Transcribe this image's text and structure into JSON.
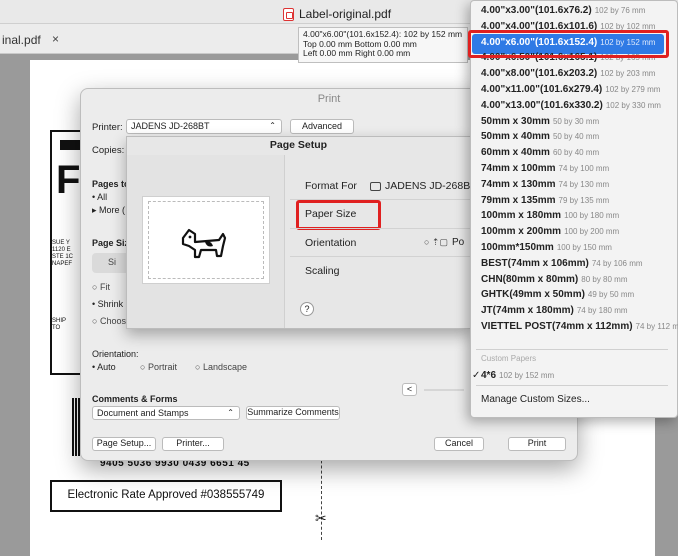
{
  "window": {
    "doc_title": "Label-original.pdf",
    "tab_label": "inal.pdf",
    "tab_close": "×"
  },
  "tooltip": {
    "line1": "4.00\"x6.00\"(101.6x152.4): 102 by 152 mm",
    "line2": "Top 0.00 mm  Bottom 0.00 mm",
    "line3": "Left 0.00 mm  Right 0.00 mm"
  },
  "document": {
    "tracking_number": "9405 5036 9930 0439 6651 45",
    "rate_text": "Electronic Rate Approved #038555749",
    "big_letter": "F",
    "address_lines": [
      "SUE Y",
      "1120 E",
      "STE 1C",
      "NAPEF"
    ],
    "ship_to_lines": [
      "SHIP",
      "TO"
    ],
    "scissors": "✂"
  },
  "print_dialog": {
    "title": "Print",
    "printer_label": "Printer:",
    "printer_value": "JADENS JD-268BT",
    "advanced_label": "Advanced",
    "copies_label": "Copies:",
    "pages_title": "Pages to",
    "pages_all": "All",
    "pages_more": "More (",
    "page_size_title": "Page Siz",
    "page_size_button": "Si",
    "fit_label": "Fit",
    "shrink_label": "Shrink",
    "choose_label": "Choos",
    "orientation_title": "Orientation:",
    "orient_auto": "Auto",
    "orient_portrait": "Portrait",
    "orient_landscape": "Landscape",
    "comments_title": "Comments & Forms",
    "comments_value": "Document and Stamps",
    "summarize_label": "Summarize Comments",
    "page_setup_label": "Page Setup...",
    "printer_button_label": "Printer...",
    "cancel_label": "Cancel",
    "print_label": "Print",
    "preview_nav": "<"
  },
  "page_setup": {
    "title": "Page Setup",
    "format_for_label": "Format For",
    "format_for_value": "JADENS JD-268B",
    "paper_size_label": "Paper Size",
    "orientation_label": "Orientation",
    "orientation_value": "Po",
    "scaling_label": "Scaling",
    "help_label": "?"
  },
  "paper_menu": {
    "items": [
      {
        "main": "4.00\"x3.00\"(101.6x76.2)",
        "sub": "102 by 76 mm"
      },
      {
        "main": "4.00\"x4.00\"(101.6x101.6)",
        "sub": "102 by 102 mm"
      },
      {
        "main": "4.00\"x6.00\"(101.6x152.4)",
        "sub": "102 by 152 mm",
        "selected": true
      },
      {
        "main": "4.00\"x6.50\"(101.6x165.1)",
        "sub": "102 by 165 mm"
      },
      {
        "main": "4.00\"x8.00\"(101.6x203.2)",
        "sub": "102 by 203 mm"
      },
      {
        "main": "4.00\"x11.00\"(101.6x279.4)",
        "sub": "102 by 279 mm"
      },
      {
        "main": "4.00\"x13.00\"(101.6x330.2)",
        "sub": "102 by 330 mm"
      },
      {
        "main": "50mm x 30mm",
        "sub": "50 by 30 mm"
      },
      {
        "main": "50mm x 40mm",
        "sub": "50 by 40 mm"
      },
      {
        "main": "60mm x 40mm",
        "sub": "60 by 40 mm"
      },
      {
        "main": "74mm x 100mm",
        "sub": "74 by 100 mm"
      },
      {
        "main": "74mm x 130mm",
        "sub": "74 by 130 mm"
      },
      {
        "main": "79mm x 135mm",
        "sub": "79 by 135 mm"
      },
      {
        "main": "100mm x 180mm",
        "sub": "100 by 180 mm"
      },
      {
        "main": "100mm x 200mm",
        "sub": "100 by 200 mm"
      },
      {
        "main": "100mm*150mm",
        "sub": "100 by 150 mm"
      },
      {
        "main": "BEST(74mm x 106mm)",
        "sub": "74 by 106 mm"
      },
      {
        "main": "CHN(80mm x 80mm)",
        "sub": "80 by 80 mm"
      },
      {
        "main": "GHTK(49mm x 50mm)",
        "sub": "49 by 50 mm"
      },
      {
        "main": "JT(74mm x 180mm)",
        "sub": "74 by 180 mm"
      },
      {
        "main": "VIETTEL POST(74mm x 112mm)",
        "sub": "74 by 112 mm"
      }
    ],
    "custom_papers_label": "Custom Papers",
    "custom_item": {
      "main": "4*6",
      "sub": "102 by 152 mm"
    },
    "custom_check": "✓",
    "manage_label": "Manage Custom Sizes..."
  },
  "colors": {
    "selection_blue": "#2f7ae5",
    "highlight_red": "#e02020"
  }
}
